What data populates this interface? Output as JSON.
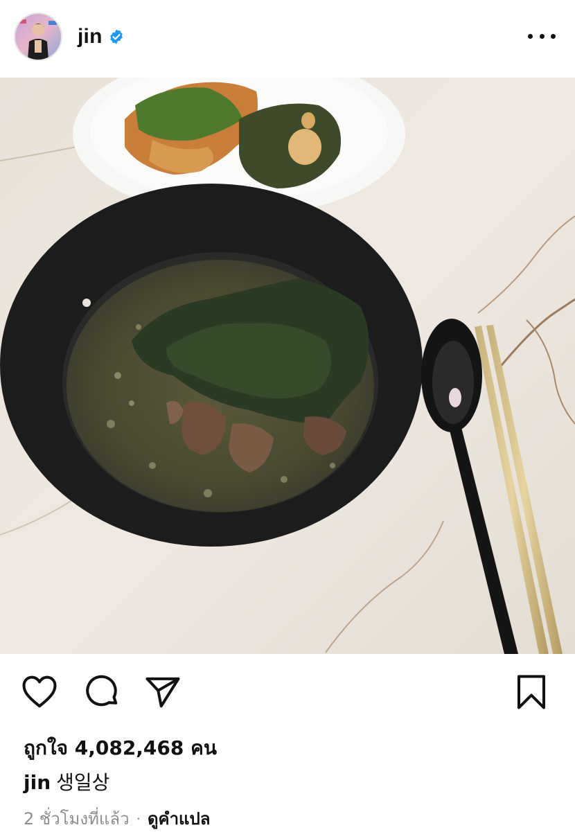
{
  "post": {
    "username": "jin",
    "verified": true,
    "likes_text": "ถูกใจ 4,082,468 คน",
    "caption_user": "jin",
    "caption_text": "생일상",
    "time_ago": "2 ชั่วโมงที่แล้ว",
    "separator": "·",
    "translate_label": "ดูคำแปล"
  },
  "icons": {
    "verified": "verified-badge-icon",
    "more": "more-options-icon",
    "like": "heart-icon",
    "comment": "comment-icon",
    "share": "send-icon",
    "save": "bookmark-icon"
  },
  "colors": {
    "verified_blue": "#1d9bf0",
    "meta_gray": "#8e8e8e",
    "text": "#111111"
  }
}
